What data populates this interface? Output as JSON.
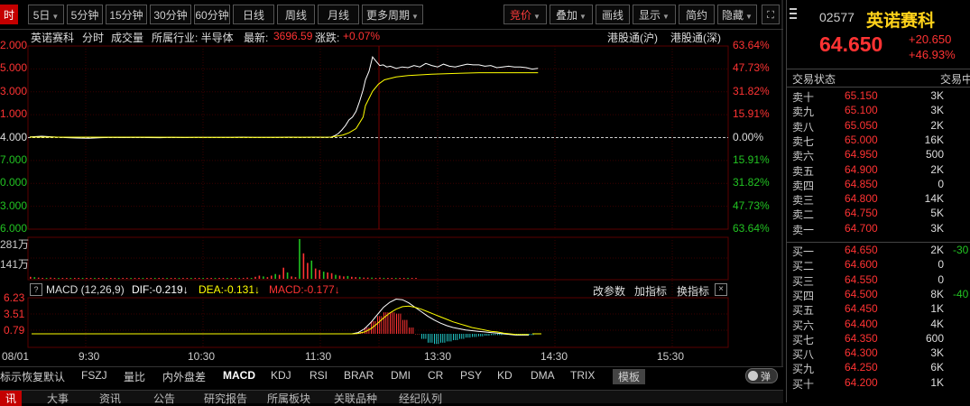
{
  "toolbar": {
    "buttons": [
      {
        "label": "时",
        "active": true
      },
      {
        "label": "5日"
      },
      {
        "label": "5分钟"
      },
      {
        "label": "15分钟"
      },
      {
        "label": "30分钟"
      },
      {
        "label": "60分钟"
      },
      {
        "label": "日线"
      },
      {
        "label": "周线"
      },
      {
        "label": "月线"
      },
      {
        "label": "更多周期"
      },
      {
        "label": "竞价"
      },
      {
        "label": "叠加"
      },
      {
        "label": "画线"
      },
      {
        "label": "显示"
      },
      {
        "label": "简约"
      },
      {
        "label": "隐藏"
      }
    ]
  },
  "info": {
    "name": "英诺赛科",
    "mode": "分时",
    "volume_label": "成交量",
    "industry": "所属行业: 半导体",
    "latest_label": "最新:",
    "latest_value": "3696.59",
    "change_label": "涨跌:",
    "change_value": "+0.07%",
    "connect1": "港股通(沪)",
    "connect2": "港股通(深)"
  },
  "chart_data": [
    {
      "type": "line",
      "title": "",
      "x_ticks": [
        "08/01",
        "9:30",
        "10:30",
        "11:30",
        "13:30",
        "14:30",
        "15:30"
      ],
      "left_ticks": [
        "2.000",
        "5.000",
        "3.000",
        "1.000",
        "4.000",
        "7.000",
        "0.000",
        "3.000",
        "6.000"
      ],
      "right_ticks": [
        "63.64%",
        "47.73%",
        "31.82%",
        "15.91%",
        "0.00%",
        "15.91%",
        "31.82%",
        "47.73%",
        "63.64%"
      ],
      "ylim_pct": [
        -63.64,
        63.64
      ],
      "series": [
        {
          "values": [
            [
              0,
              0.2
            ],
            [
              10,
              0.6
            ],
            [
              20,
              0.1
            ],
            [
              30,
              -0.3
            ],
            [
              40,
              -0.6
            ],
            [
              50,
              -0.8
            ],
            [
              60,
              -0.4
            ],
            [
              70,
              -0.2
            ],
            [
              80,
              -0.3
            ],
            [
              90,
              -0.1
            ],
            [
              100,
              -0.3
            ],
            [
              110,
              -0.4
            ],
            [
              120,
              -0.2
            ],
            [
              130,
              -0.3
            ],
            [
              140,
              -0.2
            ],
            [
              150,
              -0.1
            ],
            [
              160,
              -0.2
            ],
            [
              170,
              -0.1
            ],
            [
              180,
              0.0
            ],
            [
              190,
              -0.2
            ],
            [
              200,
              -0.1
            ],
            [
              210,
              -0.1
            ],
            [
              220,
              0.0
            ],
            [
              230,
              -0.2
            ],
            [
              240,
              0.0
            ],
            [
              250,
              -0.1
            ],
            [
              255,
              0.0
            ],
            [
              258,
              1.0
            ],
            [
              261,
              2.5
            ],
            [
              264,
              5.0
            ],
            [
              267,
              8.0
            ],
            [
              270,
              12.0
            ],
            [
              273,
              14.0
            ],
            [
              276,
              18.0
            ],
            [
              279,
              25.0
            ],
            [
              282,
              33.0
            ],
            [
              284,
              40.0
            ],
            [
              287,
              46.0
            ],
            [
              290,
              56.0
            ],
            [
              293,
              53.0
            ],
            [
              296,
              50.0
            ],
            [
              299,
              50.5
            ],
            [
              302,
              49.0
            ],
            [
              305,
              49.5
            ],
            [
              310,
              48.0
            ],
            [
              315,
              49.0
            ],
            [
              320,
              48.5
            ],
            [
              325,
              50.0
            ],
            [
              330,
              49.0
            ],
            [
              335,
              51.5
            ],
            [
              340,
              50.0
            ],
            [
              345,
              49.0
            ],
            [
              350,
              51.0
            ],
            [
              355,
              49.5
            ],
            [
              360,
              49.0
            ],
            [
              365,
              50.0
            ],
            [
              370,
              51.0
            ],
            [
              375,
              50.5
            ],
            [
              380,
              50.5
            ],
            [
              385,
              49.5
            ],
            [
              390,
              50.0
            ],
            [
              395,
              48.5
            ],
            [
              400,
              49.0
            ],
            [
              405,
              49.5
            ],
            [
              410,
              49.0
            ],
            [
              415,
              49.0
            ],
            [
              420,
              48.5
            ],
            [
              425,
              47.5
            ],
            [
              430,
              48.0
            ]
          ]
        },
        {
          "values": [
            [
              0,
              0.0
            ],
            [
              50,
              0.0
            ],
            [
              100,
              0.0
            ],
            [
              150,
              -0.1
            ],
            [
              200,
              -0.1
            ],
            [
              255,
              0.0
            ],
            [
              265,
              1.5
            ],
            [
              270,
              3.0
            ],
            [
              276,
              6.0
            ],
            [
              282,
              14.0
            ],
            [
              284,
              22.0
            ],
            [
              290,
              32.0
            ],
            [
              295,
              37.0
            ],
            [
              300,
              40.0
            ],
            [
              310,
              42.0
            ],
            [
              320,
              43.0
            ],
            [
              340,
              44.0
            ],
            [
              360,
              44.5
            ],
            [
              380,
              45.0
            ],
            [
              400,
              45.0
            ],
            [
              430,
              45.0
            ]
          ]
        }
      ]
    },
    {
      "type": "bar",
      "title": "",
      "y_ticks": [
        "281万",
        "141万"
      ],
      "values": [
        0.05,
        0.04,
        0.03,
        0.02,
        0.02,
        0.03,
        0.02,
        0.02,
        0.01,
        0.02,
        0.01,
        0.02,
        0.01,
        0.01,
        0.02,
        0.01,
        0.01,
        0.02,
        0.01,
        0.01,
        0.01,
        0.01,
        0.02,
        0.01,
        0.01,
        0.02,
        0.01,
        0.01,
        0.02,
        0.01,
        0.01,
        0.01,
        0.01,
        0.01,
        0.01,
        0.01,
        0.01,
        0.01,
        0.01,
        0.01,
        0.01,
        0.01,
        0.01,
        0.01,
        0.01,
        0.01,
        0.01,
        0.01,
        0.01,
        0.01,
        0.01,
        0.01,
        0.01,
        0.02,
        0.03,
        0.02,
        0.05,
        0.08,
        0.06,
        0.04,
        0.08,
        0.12,
        0.1,
        0.28,
        0.16,
        0.06,
        0.04,
        1.0,
        0.64,
        0.4,
        0.46,
        0.26,
        0.22,
        0.18,
        0.16,
        0.14,
        0.1,
        0.08,
        0.06,
        0.07,
        0.05,
        0.04,
        0.04,
        0.03,
        0.03,
        0.03,
        0.02,
        0.03,
        0.02,
        0.02,
        0.02,
        0.02,
        0.02,
        0.02,
        0.02,
        0.01,
        0.01
      ]
    },
    {
      "type": "line",
      "title": "MACD (12,26,9)",
      "y_ticks": [
        "6.23",
        "3.51",
        "0.79"
      ],
      "legend": [
        {
          "name": "DIF:-0.219↓",
          "color": "#ffffff"
        },
        {
          "name": "DEA:-0.131↓",
          "color": "#ffff00"
        },
        {
          "name": "MACD:-0.177↓",
          "color": "#ff3333"
        }
      ],
      "series": [
        {
          "name": "DIF",
          "values": [
            0,
            0,
            0,
            0,
            0,
            0,
            0,
            0,
            0,
            0,
            0,
            0.2,
            0.8,
            1.8,
            3.0,
            4.2,
            5.0,
            5.5,
            5.4,
            4.9,
            4.2,
            3.5,
            2.8,
            2.2,
            1.7,
            1.3,
            1.0,
            0.8,
            0.6,
            0.5,
            0.4,
            0.3,
            0.2,
            0.1,
            0.0,
            -0.1,
            -0.2,
            -0.2,
            -0.2
          ]
        },
        {
          "name": "DEA",
          "values": [
            0,
            0,
            0,
            0,
            0,
            0,
            0,
            0,
            0,
            0,
            0,
            0.05,
            0.3,
            0.8,
            1.6,
            2.5,
            3.3,
            3.9,
            4.3,
            4.4,
            4.2,
            3.9,
            3.5,
            3.1,
            2.7,
            2.3,
            1.9,
            1.6,
            1.3,
            1.0,
            0.8,
            0.6,
            0.4,
            0.3,
            0.1,
            0.0,
            -0.1,
            -0.1,
            -0.1
          ]
        }
      ],
      "histogram": [
        0,
        0,
        0,
        0,
        0,
        0,
        0,
        0,
        0,
        0,
        0,
        0.3,
        1.0,
        2.0,
        2.8,
        3.4,
        3.4,
        3.2,
        2.2,
        1.0,
        0,
        -0.8,
        -1.4,
        -1.6,
        -1.4,
        -1.2,
        -1.0,
        -0.8,
        -0.6,
        -0.5,
        -0.4,
        -0.3,
        -0.2,
        -0.2,
        -0.1,
        -0.1,
        -0.2,
        -0.2,
        -0.2
      ]
    }
  ],
  "macd_bar": {
    "param_label": "改参数",
    "add_label": "加指标",
    "switch_label": "换指标"
  },
  "indicators": [
    "标示",
    "恢复默认",
    "FSZJ",
    "量比",
    "内外盘差",
    "MACD",
    "KDJ",
    "RSI",
    "BRAR",
    "DMI",
    "CR",
    "PSY",
    "KD",
    "DMA",
    "TRIX",
    "模板"
  ],
  "indicator_active": "MACD",
  "toggle_label": "弹",
  "bottom_tabs": [
    "讯",
    "大事",
    "资讯",
    "公告",
    "研究报告",
    "所属板块",
    "关联品种",
    "经纪队列"
  ],
  "quote": {
    "code": "02577",
    "name": "英诺赛科",
    "price": "64.650",
    "change": "+20.650",
    "change_pct": "+46.93%",
    "status_label": "交易状态",
    "status_value": "交易中"
  },
  "orderbook": {
    "asks": [
      {
        "label": "卖十",
        "price": "65.150",
        "vol": "3K"
      },
      {
        "label": "卖九",
        "price": "65.100",
        "vol": "3K"
      },
      {
        "label": "卖八",
        "price": "65.050",
        "vol": "2K"
      },
      {
        "label": "卖七",
        "price": "65.000",
        "vol": "16K"
      },
      {
        "label": "卖六",
        "price": "64.950",
        "vol": "500"
      },
      {
        "label": "卖五",
        "price": "64.900",
        "vol": "2K"
      },
      {
        "label": "卖四",
        "price": "64.850",
        "vol": "0"
      },
      {
        "label": "卖三",
        "price": "64.800",
        "vol": "14K"
      },
      {
        "label": "卖二",
        "price": "64.750",
        "vol": "5K"
      },
      {
        "label": "卖一",
        "price": "64.700",
        "vol": "3K"
      }
    ],
    "bids": [
      {
        "label": "买一",
        "price": "64.650",
        "vol": "2K",
        "extra": "-30"
      },
      {
        "label": "买二",
        "price": "64.600",
        "vol": "0",
        "extra": ""
      },
      {
        "label": "买三",
        "price": "64.550",
        "vol": "0",
        "extra": ""
      },
      {
        "label": "买四",
        "price": "64.500",
        "vol": "8K",
        "extra": "-40"
      },
      {
        "label": "买五",
        "price": "64.450",
        "vol": "1K",
        "extra": ""
      },
      {
        "label": "买六",
        "price": "64.400",
        "vol": "4K",
        "extra": ""
      },
      {
        "label": "买七",
        "price": "64.350",
        "vol": "600",
        "extra": ""
      },
      {
        "label": "买八",
        "price": "64.300",
        "vol": "3K",
        "extra": ""
      },
      {
        "label": "买九",
        "price": "64.250",
        "vol": "6K",
        "extra": ""
      },
      {
        "label": "买十",
        "price": "64.200",
        "vol": "1K",
        "extra": ""
      }
    ]
  },
  "colors": {
    "up": "#ff3333",
    "down": "#22c322",
    "accent": "#c40000",
    "price_line": "#ffffff",
    "avg_line": "#ffff00"
  }
}
